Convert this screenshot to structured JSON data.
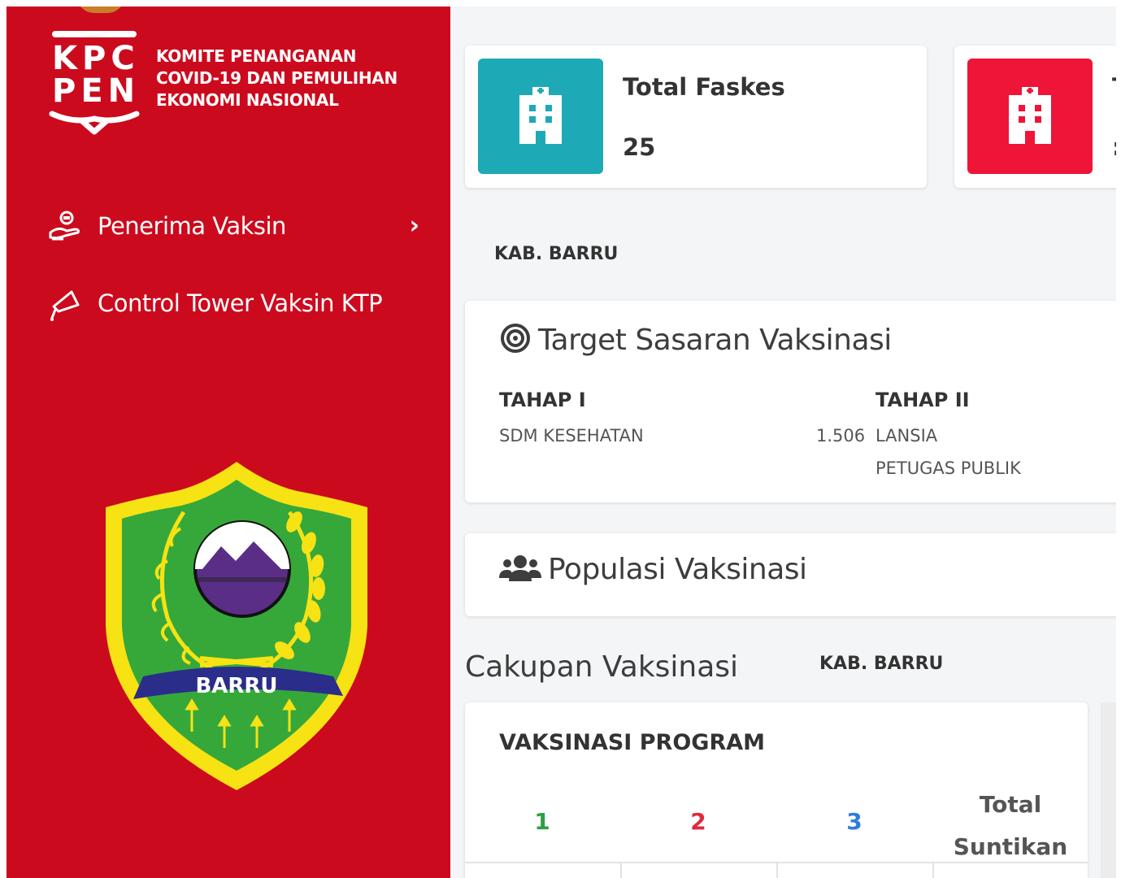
{
  "logo": {
    "mark_line1": "KPC",
    "mark_line2": "PEN",
    "text_lines": [
      "KOMITE PENANGANAN",
      "COVID-19 DAN PEMULIHAN",
      "EKONOMI NASIONAL"
    ]
  },
  "sidebar": {
    "background": "#cc0a1e",
    "items": [
      {
        "label": "Penerima Vaksin",
        "icon": "hand-vaccine-icon",
        "has_submenu": true
      },
      {
        "label": "Control Tower Vaksin KTP",
        "icon": "megaphone-icon",
        "has_submenu": false
      }
    ],
    "crest_label": "BARRU"
  },
  "stats": [
    {
      "title": "Total Faskes",
      "value": "25",
      "color": "#1ea9b7",
      "icon": "hospital-icon"
    },
    {
      "title": "T",
      "value": ":",
      "color": "#ee1538",
      "icon": "hospital-icon"
    }
  ],
  "region": "KAB. BARRU",
  "target": {
    "title": "Target Sasaran Vaksinasi",
    "icon": "target-icon",
    "tahap1": {
      "label": "TAHAP I",
      "rows": [
        {
          "name": "SDM KESEHATAN",
          "value": "1.506"
        }
      ]
    },
    "tahap2": {
      "label": "TAHAP II",
      "rows": [
        {
          "name": "LANSIA"
        },
        {
          "name": "PETUGAS PUBLIK"
        }
      ]
    }
  },
  "populasi": {
    "title": "Populasi Vaksinasi",
    "icon": "users-icon"
  },
  "cakupan": {
    "title": "Cakupan Vaksinasi",
    "region": "KAB. BARRU"
  },
  "program": {
    "title": "VAKSINASI PROGRAM",
    "columns": [
      "1",
      "2",
      "3"
    ],
    "total_line1": "Total",
    "total_line2": "Suntikan",
    "column_colors": [
      "#2ea043",
      "#e0283c",
      "#2b7de0"
    ]
  }
}
